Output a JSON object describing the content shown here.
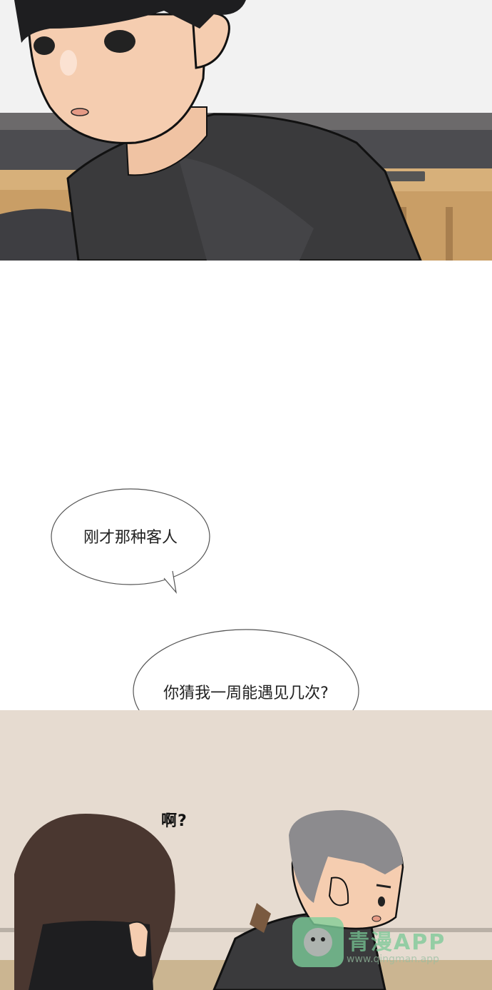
{
  "bubbles": {
    "first": "刚才那种客人",
    "second": "你猜我一周能遇见几次?"
  },
  "sound_effect": "啊?",
  "watermark": {
    "brand": "青漫APP",
    "url": "www.qingman.app"
  },
  "colors": {
    "shirt": "#3a3a3c",
    "hair_dark": "#1e1e20",
    "skin": "#f5cdb0",
    "table": "#d7b07a",
    "bottom_background": "#e6dbd0",
    "gray_hair": "#8c8b8e",
    "brown_hair": "#4a3730",
    "watermark_green": "#7dcf9b"
  }
}
